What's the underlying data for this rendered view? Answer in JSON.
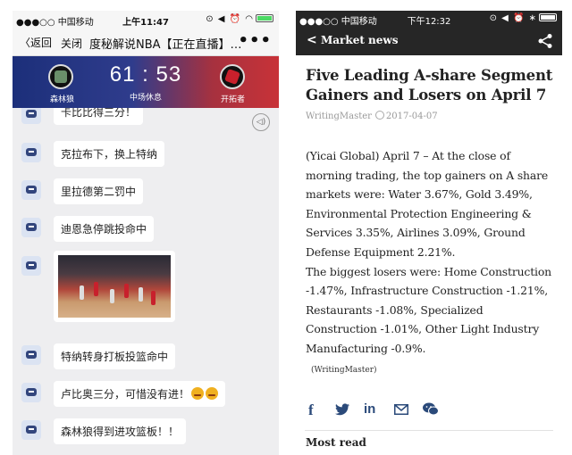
{
  "left_phone": {
    "status": {
      "carrier": "●●●○○ 中国移动",
      "time": "上午11:47",
      "icons": "⊙ ◀ ⏰ ◠"
    },
    "nav": {
      "back_label": "返回",
      "close_label": "关闭",
      "title": "度秘解说NBA【正在直播】…",
      "more_label": "•••"
    },
    "scoreboard": {
      "home_team": "森林狼",
      "away_team": "开拓者",
      "score": "61 : 53",
      "period": "中场休息"
    },
    "messages": [
      {
        "text": "卡比比得三分！"
      },
      {
        "text": "克拉布下，换上特纳"
      },
      {
        "text": "里拉德第二罚中"
      },
      {
        "text": "迪恩急停跳投命中"
      },
      {
        "text": "特纳转身打板投篮命中"
      },
      {
        "text": "卢比奥三分，可惜没有进！"
      },
      {
        "text": "森林狼得到进攻篮板！！"
      }
    ],
    "sound_label": "◁)"
  },
  "right_phone": {
    "status": {
      "carrier": "●●●○○ 中国移动",
      "time": "下午12:32",
      "icons": "⊙ ◀ ⏰ ∗"
    },
    "nav": {
      "section_title": "Market news"
    },
    "article": {
      "headline": "Five Leading A-share Segment Gainers and Losers on April 7",
      "author": "WritingMaster",
      "date": "2017-04-07",
      "paragraph1": "(Yicai Global) April 7 – At the close of morning trading, the top gainers on A share markets were: Water 3.67%, Gold 3.49%, Environmental Protection Engineering & Services 3.35%, Airlines 3.09%, Ground Defense Equipment 2.21%.",
      "paragraph2": "The biggest losers were: Home Construction -1.47%, Infrastructure Construction -1.21%, Restaurants -1.08%, Specialized Construction -1.01%, Other Light Industry Manufacturing -0.9%.",
      "byline": "(WritingMaster)"
    },
    "share_icons": [
      "f",
      "twitter-icon",
      "in",
      "mail-icon",
      "wechat-icon"
    ],
    "most_read": "Most read"
  },
  "colors": {
    "score_left": "#1c2f7a",
    "score_right": "#c83238",
    "dark_nav": "#262626",
    "share_blue": "#2b4a7a"
  }
}
